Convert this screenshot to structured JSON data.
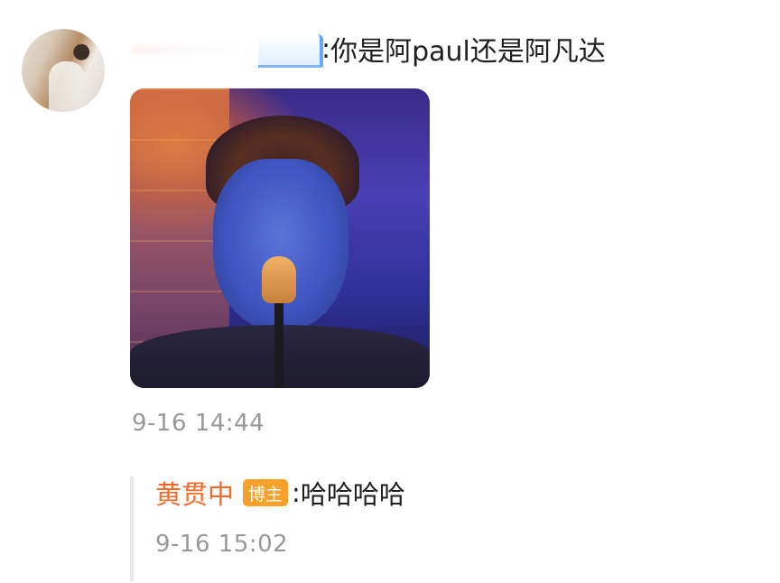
{
  "comment": {
    "text": "你是阿paul还是阿凡达",
    "timestamp": "9-16 14:44"
  },
  "reply": {
    "author": "黄贯中",
    "badge": "博主",
    "text": "哈哈哈哈",
    "timestamp": "9-16 15:02"
  },
  "colors": {
    "author_name": "#f26b2a",
    "badge_bg": "#f8a12a",
    "timestamp": "#999999"
  }
}
